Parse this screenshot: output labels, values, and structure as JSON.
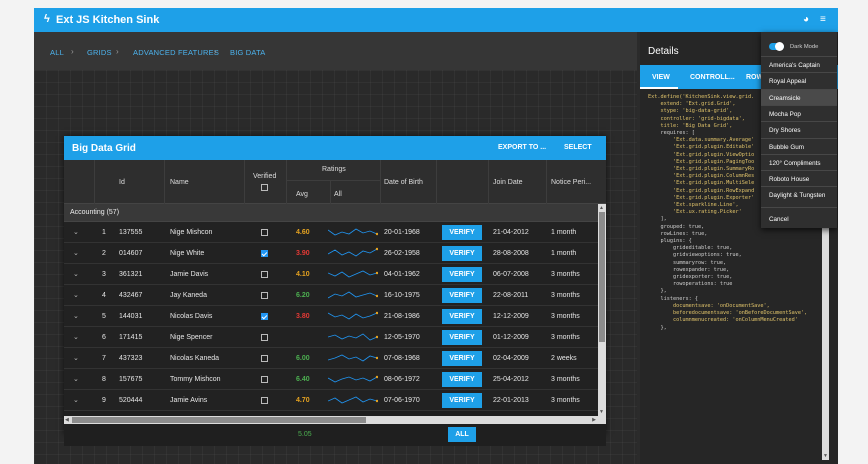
{
  "app": {
    "title": "Ext JS Kitchen Sink"
  },
  "breadcrumb": [
    "ALL",
    "GRIDS",
    "ADVANCED FEATURES",
    "BIG DATA"
  ],
  "grid": {
    "title": "Big Data Grid",
    "export_label": "EXPORT TO ...",
    "select_label": "SELECT",
    "columns": {
      "id": "Id",
      "name": "Name",
      "verified": "Verified",
      "ratings": "Ratings",
      "avg": "Avg",
      "all": "All",
      "dob": "Date of Birth",
      "join": "Join Date",
      "notice": "Notice Peri..."
    },
    "group_label": "Accounting (57)",
    "verify_label": "VERIFY",
    "rows": [
      {
        "num": "1",
        "id": "137555",
        "name": "Nige Mishcon",
        "verified": false,
        "avg": "4.60",
        "avg_color": "#e6a320",
        "dob": "20-01-1968",
        "join": "21-04-2012",
        "notice": "1 month"
      },
      {
        "num": "2",
        "id": "014607",
        "name": "Nige White",
        "verified": true,
        "avg": "3.90",
        "avg_color": "#e53935",
        "dob": "26-02-1958",
        "join": "28-08-2008",
        "notice": "1 month"
      },
      {
        "num": "3",
        "id": "361321",
        "name": "Jamie Davis",
        "verified": false,
        "avg": "4.10",
        "avg_color": "#e6a320",
        "dob": "04-01-1962",
        "join": "06-07-2008",
        "notice": "3 months"
      },
      {
        "num": "4",
        "id": "432467",
        "name": "Jay Kaneda",
        "verified": false,
        "avg": "6.20",
        "avg_color": "#4caf50",
        "dob": "16-10-1975",
        "join": "22-08-2011",
        "notice": "3 months"
      },
      {
        "num": "5",
        "id": "144031",
        "name": "Nicolas Davis",
        "verified": true,
        "avg": "3.80",
        "avg_color": "#e53935",
        "dob": "21-08-1986",
        "join": "12-12-2009",
        "notice": "3 months"
      },
      {
        "num": "6",
        "id": "171415",
        "name": "Nige Spencer",
        "verified": false,
        "avg": "",
        "avg_color": "#3f51b5",
        "dob": "12-05-1970",
        "join": "01-12-2009",
        "notice": "3 months"
      },
      {
        "num": "7",
        "id": "437323",
        "name": "Nicolas Kaneda",
        "verified": false,
        "avg": "6.00",
        "avg_color": "#4caf50",
        "dob": "07-08-1968",
        "join": "02-04-2009",
        "notice": "2 weeks"
      },
      {
        "num": "8",
        "id": "157675",
        "name": "Tommy Mishcon",
        "verified": false,
        "avg": "6.40",
        "avg_color": "#4caf50",
        "dob": "08-06-1972",
        "join": "25-04-2012",
        "notice": "3 months"
      },
      {
        "num": "9",
        "id": "520444",
        "name": "Jamie Avins",
        "verified": false,
        "avg": "4.70",
        "avg_color": "#e6a320",
        "dob": "07-06-1970",
        "join": "22-01-2013",
        "notice": "3 months"
      }
    ],
    "summary": {
      "avg": "5.05",
      "all_label": "ALL"
    }
  },
  "details": {
    "title": "Details",
    "tabs": [
      "VIEW",
      "CONTROLL...",
      "ROW"
    ],
    "code": [
      "Ext.define('KitchenSink.view.grid.",
      "    extend: 'Ext.grid.Grid',",
      "    xtype: 'big-data-grid',",
      "    controller: 'grid-bigdata',",
      "    title: 'Big Data Grid',",
      "",
      "    requires: [",
      "        'Ext.data.summary.Average'",
      "",
      "        'Ext.grid.plugin.Editable'",
      "        'Ext.grid.plugin.ViewOptio",
      "        'Ext.grid.plugin.PagingToo",
      "        'Ext.grid.plugin.SummaryRo",
      "        'Ext.grid.plugin.ColumnRes",
      "        'Ext.grid.plugin.MultiSele",
      "        'Ext.grid.plugin.RowExpand",
      "        'Ext.grid.plugin.Exporter'",
      "",
      "        'Ext.sparkline.Line',",
      "        'Ext.ux.rating.Picker'",
      "    ],",
      "",
      "    grouped: true,",
      "    rowLines: true,",
      "",
      "    plugins: {",
      "        grideditable: true,",
      "        gridviewoptions: true,",
      "        summaryrow: true,",
      "        rowexpander: true,",
      "        gridexporter: true,",
      "        rowoperations: true",
      "    },",
      "",
      "    listeners: {",
      "        documentsave: 'onDocumentSave',",
      "        beforedocumentsave: 'onBeforeDocumentSave',",
      "        columnmenucreated: 'onColumnMenuCreated'",
      "    },"
    ]
  },
  "theme_menu": {
    "dark_mode_label": "Dark Mode",
    "items": [
      "America's Captain",
      "Royal Appeal",
      "Creamsicle",
      "Mocha Pop",
      "Dry Shores",
      "Bubble Gum",
      "120° Compliments",
      "Roboto House",
      "Daylight & Tungsten"
    ],
    "selected": "Creamsicle",
    "cancel_label": "Cancel"
  },
  "colors": {
    "accent": "#1ea0e8",
    "sparkline": "#2196f3"
  }
}
